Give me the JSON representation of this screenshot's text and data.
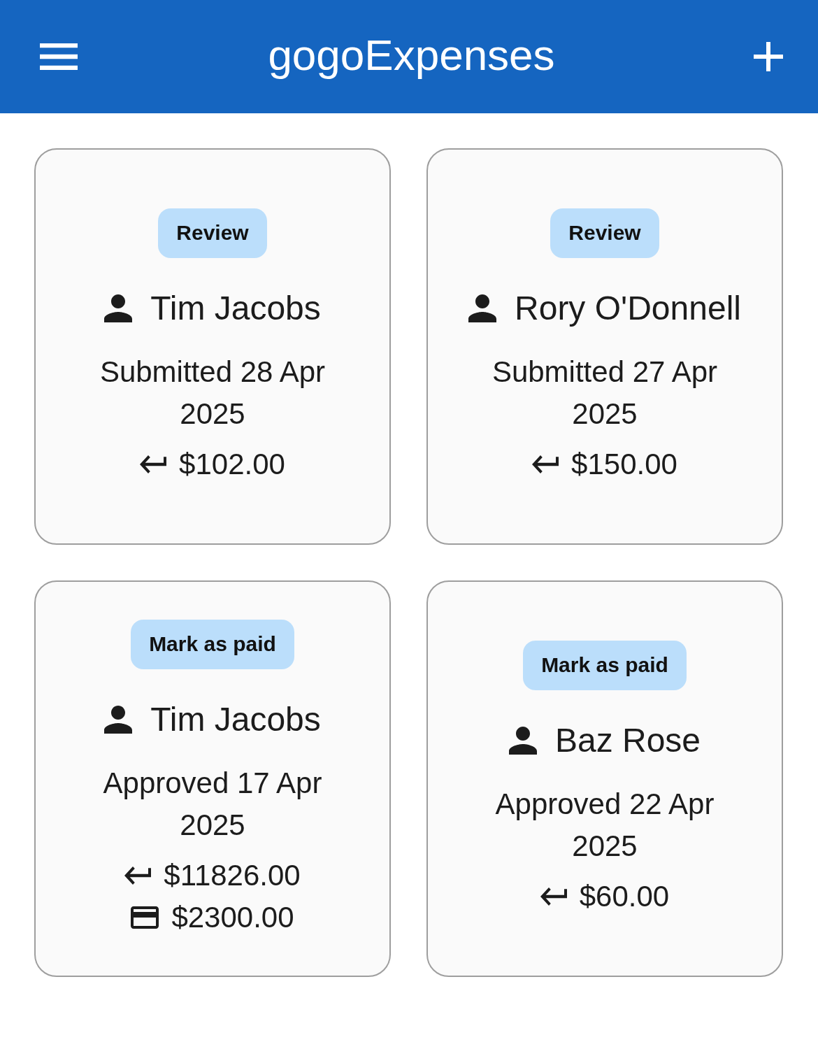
{
  "app_bar": {
    "title": "gogoExpenses"
  },
  "cards": [
    {
      "action": "Review",
      "name": "Tim Jacobs",
      "status_text": "Submitted 28 Apr 2025",
      "amounts": [
        {
          "kind": "reimbursement",
          "value": "$102.00"
        }
      ]
    },
    {
      "action": "Review",
      "name": "Rory O'Donnell",
      "status_text": "Submitted 27 Apr 2025",
      "amounts": [
        {
          "kind": "reimbursement",
          "value": "$150.00"
        }
      ]
    },
    {
      "action": "Mark as paid",
      "name": "Tim Jacobs",
      "status_text": "Approved 17 Apr 2025",
      "amounts": [
        {
          "kind": "reimbursement",
          "value": "$11826.00"
        },
        {
          "kind": "card",
          "value": "$2300.00"
        }
      ]
    },
    {
      "action": "Mark as paid",
      "name": "Baz Rose",
      "status_text": "Approved 22 Apr 2025",
      "amounts": [
        {
          "kind": "reimbursement",
          "value": "$60.00"
        }
      ]
    }
  ]
}
